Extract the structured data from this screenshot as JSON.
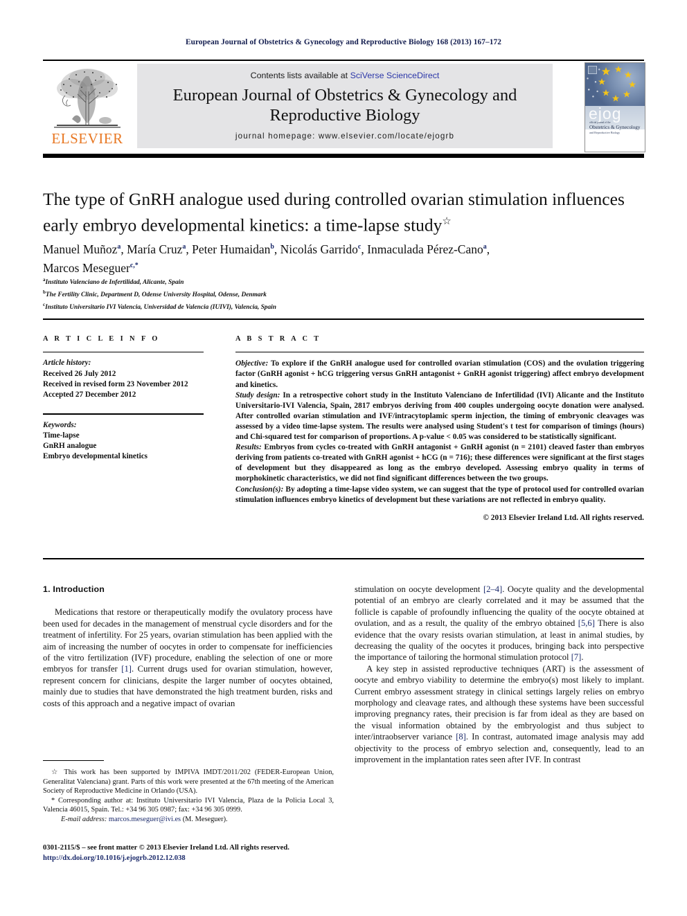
{
  "running_head": "European Journal of Obstetrics & Gynecology and Reproductive Biology 168 (2013) 167–172",
  "masthead": {
    "contents_prefix": "Contents lists available at ",
    "sciencedirect": "SciVerse ScienceDirect",
    "journal_title_line1": "European Journal of Obstetrics & Gynecology and",
    "journal_title_line2": "Reproductive Biology",
    "homepage": "journal homepage: www.elsevier.com/locate/ejogrb",
    "publisher_wordmark": "ELSEVIER",
    "cover": {
      "brand": "ejog",
      "line_top": "official journal of the",
      "line_main": "Obstetrics & Gynecology",
      "line_sub": "and Reproductive Biology"
    }
  },
  "article": {
    "title": "The type of GnRH analogue used during controlled ovarian stimulation influences early embryo developmental kinetics: a time-lapse study",
    "title_marker": "☆",
    "authors_line1": "Manuel Muñoz a, María Cruz a, Peter Humaidan b, Nicolás Garrido c, Inmaculada Pérez-Cano a,",
    "authors_line2": "Marcos Meseguer c,*",
    "affiliations": [
      {
        "marker": "a",
        "text": "Instituto Valenciano de Infertilidad, Alicante, Spain"
      },
      {
        "marker": "b",
        "text": "The Fertility Clinic, Department D, Odense University Hospital, Odense, Denmark"
      },
      {
        "marker": "c",
        "text": "Instituto Universitario IVI Valencia, Universidad de Valencia (IUIVI), Valencia, Spain"
      }
    ]
  },
  "article_info": {
    "heading": "A R T I C L E   I N F O",
    "history_label": "Article history:",
    "history": [
      "Received 26 July 2012",
      "Received in revised form 23 November 2012",
      "Accepted 27 December 2012"
    ],
    "keywords_label": "Keywords:",
    "keywords": [
      "Time-lapse",
      "GnRH analogue",
      "Embryo developmental kinetics"
    ]
  },
  "abstract": {
    "heading": "A B S T R A C T",
    "objective_label": "Objective:",
    "objective_text": " To explore if the GnRH analogue used for controlled ovarian stimulation (COS) and the ovulation triggering factor (GnRH agonist + hCG triggering versus GnRH antagonist + GnRH agonist triggering) affect embryo development and kinetics.",
    "design_label": "Study design:",
    "design_text": " In a retrospective cohort study in the Instituto Valenciano de Infertilidad (IVI) Alicante and the Instituto Universitario-IVI Valencia, Spain, 2817 embryos deriving from 400 couples undergoing oocyte donation were analysed. After controlled ovarian stimulation and IVF/intracytoplamic sperm injection, the timing of embryonic cleavages was assessed by a video time-lapse system. The results were analysed using Student's t test for comparison of timings (hours) and Chi-squared test for comparison of proportions. A p-value < 0.05 was considered to be statistically significant.",
    "results_label": "Results:",
    "results_text": " Embryos from cycles co-treated with GnRH antagonist + GnRH agonist (n = 2101) cleaved faster than embryos deriving from patients co-treated with GnRH agonist + hCG (n = 716); these differences were significant at the first stages of development but they disappeared as long as the embryo developed. Assessing embryo quality in terms of morphokinetic characteristics, we did not find significant differences between the two groups.",
    "conclusion_label": "Conclusion(s):",
    "conclusion_text": " By adopting a time-lapse video system, we can suggest that the type of protocol used for controlled ovarian stimulation influences embryo kinetics of development but these variations are not reflected in embryo quality.",
    "copyright": "© 2013 Elsevier Ireland Ltd. All rights reserved."
  },
  "introduction": {
    "heading": "1. Introduction",
    "left_p1": "Medications that restore or therapeutically modify the ovulatory process have been used for decades in the management of menstrual cycle disorders and for the treatment of infertility. For 25 years, ovarian stimulation has been applied with the aim of increasing the number of oocytes in order to compensate for inefficiencies of the vitro fertilization (IVF) procedure, enabling the selection of one or more embryos for transfer [1]. Current drugs used for ovarian stimulation, however, represent concern for clinicians, despite the larger number of oocytes obtained, mainly due to studies that have demonstrated the high treatment burden, risks and costs of this approach and a negative impact of ovarian",
    "right_p1_cont": "stimulation on oocyte development [2–4]. Oocyte quality and the developmental potential of an embryo are clearly correlated and it may be assumed that the follicle is capable of profoundly influencing the quality of the oocyte obtained at ovulation, and as a result, the quality of the embryo obtained [5,6] There is also evidence that the ovary resists ovarian stimulation, at least in animal studies, by decreasing the quality of the oocytes it produces, bringing back into perspective the importance of tailoring the hormonal stimulation protocol [7].",
    "right_p2": "A key step in assisted reproductive techniques (ART) is the assessment of oocyte and embryo viability to determine the embryo(s) most likely to implant. Current embryo assessment strategy in clinical settings largely relies on embryo morphology and cleavage rates, and although these systems have been successful improving pregnancy rates, their precision is far from ideal as they are based on the visual information obtained by the embryologist and thus subject to inter/intraobserver variance [8]. In contrast, automated image analysis may add objectivity to the process of embryo selection and, consequently, lead to an improvement in the implantation rates seen after IVF. In contrast"
  },
  "footnotes": {
    "funding": "☆ This work has been supported by IMPIVA IMDT/2011/202 (FEDER-European Union, Generalitat Valenciana) grant. Parts of this work were presented at the 67th meeting of the American Society of Reproductive Medicine in Orlando (USA).",
    "corresponding": "* Corresponding author at: Instituto Universitario IVI Valencia, Plaza de la Policia Local 3, Valencia 46015, Spain. Tel.: +34 96 305 0987; fax: +34 96 305 0999.",
    "email_label": "E-mail address:",
    "email": "marcos.meseguer@ivi.es",
    "email_suffix": " (M. Meseguer)."
  },
  "frontmatter": {
    "line1": "0301-2115/$ – see front matter © 2013 Elsevier Ireland Ltd. All rights reserved.",
    "doi": "http://dx.doi.org/10.1016/j.ejogrb.2012.12.038"
  }
}
